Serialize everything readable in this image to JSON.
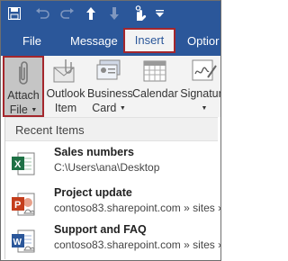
{
  "tabs": {
    "file": "File",
    "message": "Message",
    "insert": "Insert",
    "options": "Optior"
  },
  "ribbon": {
    "attach_file": {
      "line1": "Attach",
      "line2": "File"
    },
    "outlook_item": {
      "line1": "Outlook",
      "line2": "Item"
    },
    "business_card": {
      "line1": "Business",
      "line2": "Card"
    },
    "calendar": {
      "line1": "Calendar"
    },
    "signature": {
      "line1": "Signature"
    }
  },
  "menu": {
    "header": "Recent Items",
    "items": [
      {
        "name": "Sales numbers",
        "path": "C:\\Users\\ana\\Desktop",
        "icon": "excel-icon",
        "color": "#1e7145"
      },
      {
        "name": "Project update",
        "path": "contoso83.sharepoint.com » sites »",
        "icon": "powerpoint-icon",
        "color": "#c43e1c"
      },
      {
        "name": "Support and FAQ",
        "path": "contoso83.sharepoint.com » sites »",
        "icon": "word-icon",
        "color": "#2b579a"
      }
    ]
  },
  "colors": {
    "accent": "#2b579a",
    "highlight_border": "#a4262c"
  }
}
